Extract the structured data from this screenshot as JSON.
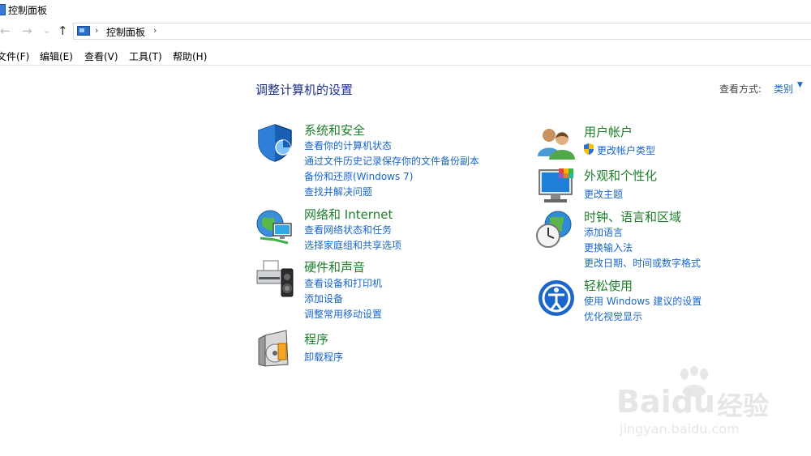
{
  "window": {
    "title": "控制面板"
  },
  "nav": {
    "back_icon": "←",
    "forward_icon": "→",
    "dropdown_icon": "⌄",
    "up_icon": "↑"
  },
  "address": {
    "crumb": "控制面板",
    "sep1": "›",
    "sep2": "›"
  },
  "menu": [
    {
      "label": "文件(F)"
    },
    {
      "label": "编辑(E)"
    },
    {
      "label": "查看(V)"
    },
    {
      "label": "工具(T)"
    },
    {
      "label": "帮助(H)"
    }
  ],
  "main": {
    "title": "调整计算机的设置",
    "view_by_label": "查看方式:",
    "view_by_value": "类别",
    "view_by_arrow": "▼"
  },
  "categories": {
    "security": {
      "title": "系统和安全",
      "links": [
        "查看你的计算机状态",
        "通过文件历史记录保存你的文件备份副本",
        "备份和还原(Windows 7)",
        "查找并解决问题"
      ]
    },
    "network": {
      "title": "网络和 Internet",
      "links": [
        "查看网络状态和任务",
        "选择家庭组和共享选项"
      ]
    },
    "hardware": {
      "title": "硬件和声音",
      "links": [
        "查看设备和打印机",
        "添加设备",
        "调整常用移动设置"
      ]
    },
    "programs": {
      "title": "程序",
      "links": [
        "卸载程序"
      ]
    },
    "users": {
      "title": "用户帐户",
      "links": [
        "更改帐户类型"
      ]
    },
    "appearance": {
      "title": "外观和个性化",
      "links": [
        "更改主题"
      ]
    },
    "clock": {
      "title": "时钟、语言和区域",
      "links": [
        "添加语言",
        "更换输入法",
        "更改日期、时间或数字格式"
      ]
    },
    "ease": {
      "title": "轻松使用",
      "links": [
        "使用 Windows 建议的设置",
        "优化视觉显示"
      ]
    }
  },
  "watermark": {
    "brand": "Baidu",
    "brand_cn": "经验",
    "url": "jingyan.baidu.com"
  }
}
